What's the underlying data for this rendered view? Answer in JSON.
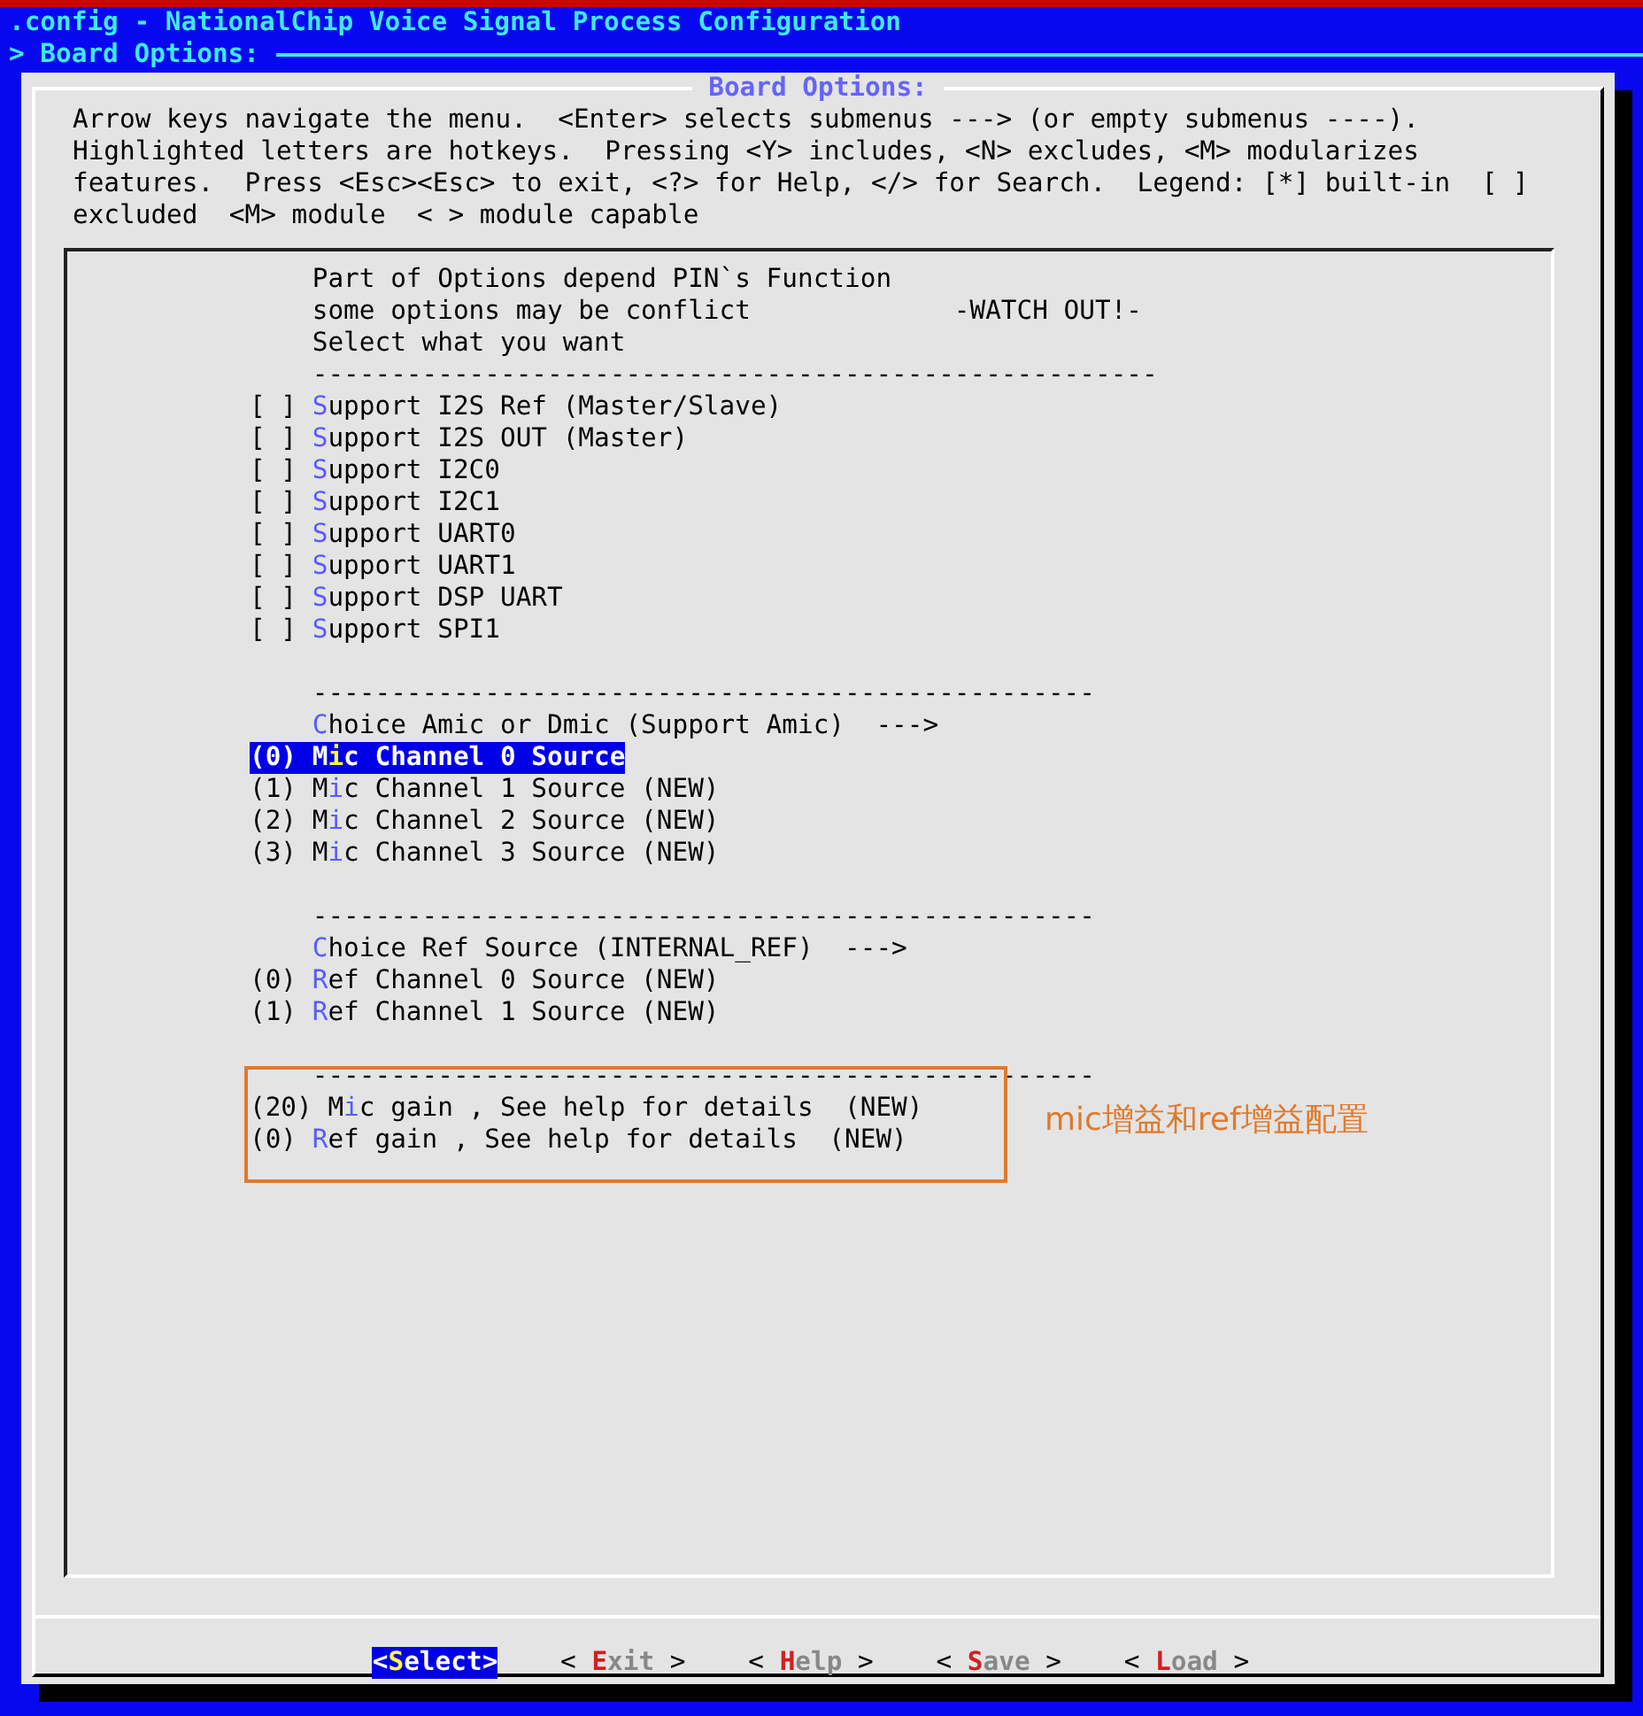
{
  "window": {
    "title": ".config - NationalChip Voice Signal Process Configuration",
    "breadcrumb": "> Board Options:"
  },
  "dialog": {
    "title": "Board Options:",
    "help": [
      "Arrow keys navigate the menu.  <Enter> selects submenus ---> (or empty submenus ----).",
      "Highlighted letters are hotkeys.  Pressing <Y> includes, <N> excludes, <M> modularizes",
      "features.  Press <Esc><Esc> to exit, <?> for Help, </> for Search.  Legend: [*] built-in  [ ]",
      "excluded  <M> module  < > module capable"
    ]
  },
  "menu": [
    {
      "kind": "text",
      "text": "Part of Options depend PIN`s Function"
    },
    {
      "kind": "text",
      "text": "some options may be conflict",
      "note": "-WATCH OUT!-"
    },
    {
      "kind": "text",
      "text": "Select what you want"
    },
    {
      "kind": "separator",
      "text": "------------------------------------------------------"
    },
    {
      "kind": "checkbox",
      "prefix": "[ ]",
      "checked": false,
      "hotkey": "S",
      "text_after": "upport I2S Ref (Master/Slave)",
      "selected": false
    },
    {
      "kind": "checkbox",
      "prefix": "[ ]",
      "checked": false,
      "hotkey": "S",
      "text_after": "upport I2S OUT (Master)",
      "selected": false
    },
    {
      "kind": "checkbox",
      "prefix": "[ ]",
      "checked": false,
      "hotkey": "S",
      "text_after": "upport I2C0",
      "selected": false
    },
    {
      "kind": "checkbox",
      "prefix": "[ ]",
      "checked": false,
      "hotkey": "S",
      "text_after": "upport I2C1",
      "selected": false
    },
    {
      "kind": "checkbox",
      "prefix": "[ ]",
      "checked": false,
      "hotkey": "S",
      "text_after": "upport UART0",
      "selected": false
    },
    {
      "kind": "checkbox",
      "prefix": "[ ]",
      "checked": false,
      "hotkey": "S",
      "text_after": "upport UART1",
      "selected": false
    },
    {
      "kind": "checkbox",
      "prefix": "[ ]",
      "checked": false,
      "hotkey": "S",
      "text_after": "upport DSP UART",
      "selected": false
    },
    {
      "kind": "checkbox",
      "prefix": "[ ]",
      "checked": false,
      "hotkey": "S",
      "text_after": "upport SPI1",
      "selected": false
    },
    {
      "kind": "blank"
    },
    {
      "kind": "separator",
      "text": "--------------------------------------------------"
    },
    {
      "kind": "submenu",
      "hotkey": "C",
      "text_after": "hoice Amic or Dmic (Support Amic)  --->",
      "selected": false
    },
    {
      "kind": "value",
      "prefix": "(0)",
      "text_before": "M",
      "hotkey": "i",
      "text_after": "c Channel 0 Source",
      "selected": true
    },
    {
      "kind": "value",
      "prefix": "(1)",
      "text_before": "M",
      "hotkey": "i",
      "text_after": "c Channel 1 Source (NEW)",
      "selected": false
    },
    {
      "kind": "value",
      "prefix": "(2)",
      "text_before": "M",
      "hotkey": "i",
      "text_after": "c Channel 2 Source (NEW)",
      "selected": false
    },
    {
      "kind": "value",
      "prefix": "(3)",
      "text_before": "M",
      "hotkey": "i",
      "text_after": "c Channel 3 Source (NEW)",
      "selected": false
    },
    {
      "kind": "blank"
    },
    {
      "kind": "separator",
      "text": "--------------------------------------------------"
    },
    {
      "kind": "submenu",
      "hotkey": "C",
      "text_after": "hoice Ref Source (INTERNAL_REF)  --->",
      "selected": false
    },
    {
      "kind": "value",
      "prefix": "(0)",
      "hotkey": "R",
      "text_after": "ef Channel 0 Source (NEW)",
      "selected": false
    },
    {
      "kind": "value",
      "prefix": "(1)",
      "hotkey": "R",
      "text_after": "ef Channel 1 Source (NEW)",
      "selected": false
    },
    {
      "kind": "blank"
    },
    {
      "kind": "separator",
      "text": "--------------------------------------------------"
    },
    {
      "kind": "value",
      "prefix": "(20)",
      "text_before": "M",
      "hotkey": "i",
      "text_after": "c gain , See help for details  (NEW)",
      "selected": false
    },
    {
      "kind": "value",
      "prefix": "(0)",
      "hotkey": "R",
      "text_after": "ef gain , See help for details  (NEW)",
      "selected": false
    }
  ],
  "annotation": {
    "text": "mic增益和ref增益配置"
  },
  "buttons": [
    {
      "open": "<",
      "hotkey": "S",
      "rest": "elect",
      "close": ">",
      "selected": true
    },
    {
      "open": "< ",
      "hotkey": "E",
      "rest": "xit",
      "close": " >",
      "selected": false
    },
    {
      "open": "< ",
      "hotkey": "H",
      "rest": "elp",
      "close": " >",
      "selected": false
    },
    {
      "open": "< ",
      "hotkey": "S",
      "rest": "ave",
      "close": " >",
      "selected": false
    },
    {
      "open": "< ",
      "hotkey": "L",
      "rest": "oad",
      "close": " >",
      "selected": false
    }
  ]
}
